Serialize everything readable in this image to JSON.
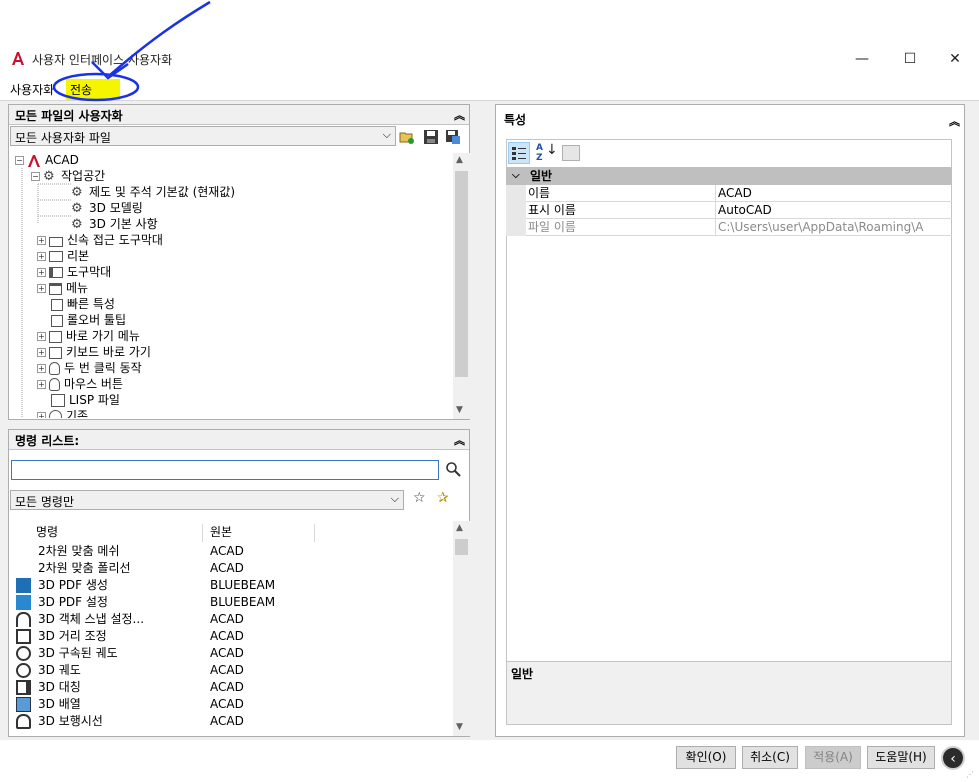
{
  "window": {
    "title": "사용자 인터페이스 사용자화",
    "minimize": "—",
    "maximize": "☐",
    "close": "✕"
  },
  "tabs": [
    {
      "label": "사용자화"
    },
    {
      "label": "전송"
    }
  ],
  "customizations_panel": {
    "header": "모든 파일의 사용자화",
    "file_select": "모든 사용자화 파일",
    "tree": [
      {
        "label": "ACAD"
      },
      {
        "label": "작업공간"
      },
      {
        "label": "제도 및 주석 기본값 (현재값)"
      },
      {
        "label": "3D 모델링"
      },
      {
        "label": "3D 기본 사항"
      },
      {
        "label": "신속 접근 도구막대"
      },
      {
        "label": "리본"
      },
      {
        "label": "도구막대"
      },
      {
        "label": "메뉴"
      },
      {
        "label": "빠른 특성"
      },
      {
        "label": "롤오버 툴팁"
      },
      {
        "label": "바로 가기 메뉴"
      },
      {
        "label": "키보드 바로 가기"
      },
      {
        "label": "두 번 클릭 동작"
      },
      {
        "label": "마우스 버튼"
      },
      {
        "label": "LISP 파일"
      },
      {
        "label": "기존"
      }
    ]
  },
  "command_list": {
    "header": "명령 리스트:",
    "search_value": "",
    "filter_select": "모든 명령만",
    "columns": [
      "명령",
      "원본"
    ],
    "rows": [
      {
        "command": "2차원 맞춤 메쉬",
        "source": "ACAD"
      },
      {
        "command": "2차원 맞춤 폴리선",
        "source": "ACAD"
      },
      {
        "command": "3D PDF 생성",
        "source": "BLUEBEAM"
      },
      {
        "command": "3D PDF 설정",
        "source": "BLUEBEAM"
      },
      {
        "command": "3D 객체 스냅 설정...",
        "source": "ACAD"
      },
      {
        "command": "3D 거리 조정",
        "source": "ACAD"
      },
      {
        "command": "3D 구속된 궤도",
        "source": "ACAD"
      },
      {
        "command": "3D 궤도",
        "source": "ACAD"
      },
      {
        "command": "3D 대칭",
        "source": "ACAD"
      },
      {
        "command": "3D 배열",
        "source": "ACAD"
      },
      {
        "command": "3D 보행시선",
        "source": "ACAD"
      }
    ]
  },
  "properties_panel": {
    "header": "특성",
    "category": "일반",
    "rows": [
      {
        "name": "이름",
        "value": "ACAD"
      },
      {
        "name": "표시 이름",
        "value": "AutoCAD"
      },
      {
        "name": "파일 이름",
        "value": "C:\\Users\\user\\AppData\\Roaming\\A"
      }
    ],
    "description_title": "일반"
  },
  "buttons": {
    "ok": "확인(O)",
    "cancel": "취소(C)",
    "apply": "적용(A)",
    "help": "도움말(H)"
  },
  "colors": {
    "accent_highlight": "#f5f500",
    "annotation_blue": "#1a32e6",
    "app_red": "#c8102e"
  }
}
